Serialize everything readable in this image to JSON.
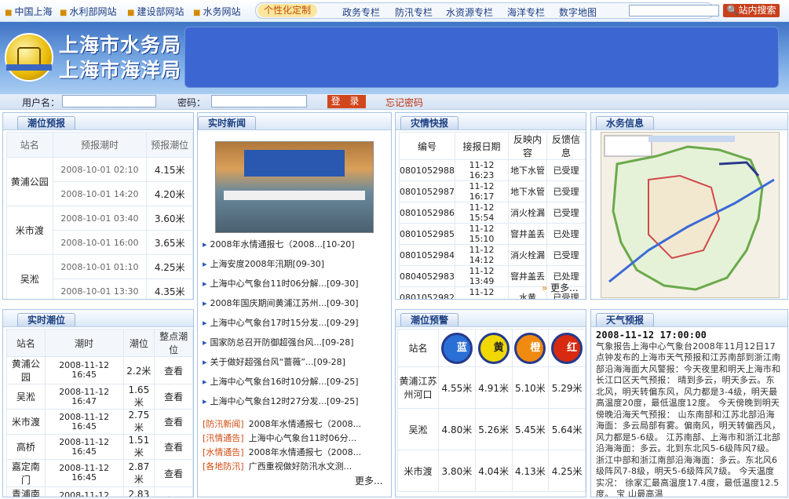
{
  "nav": {
    "links": [
      "中国上海",
      "水利部网站",
      "建设部网站",
      "水务网站"
    ],
    "tabs": [
      "个性化定制",
      "政务专栏",
      "防汛专栏",
      "水资源专栏",
      "海洋专栏",
      "数字地图"
    ],
    "search_button": "站内搜索"
  },
  "header": {
    "title1": "上海市水务局",
    "title2": "上海市海洋局"
  },
  "login": {
    "user_label": "用户名：",
    "pwd_label": "密码：",
    "login_button": "登 录",
    "forgot": "忘记密码"
  },
  "tide_forecast": {
    "title": "潮位预报",
    "headers": [
      "站名",
      "预报潮时",
      "预报潮位"
    ],
    "rows": [
      {
        "station": "黄浦公园",
        "items": [
          {
            "time": "2008-10-01 02:10",
            "level": "4.15米"
          },
          {
            "time": "2008-10-01 14:20",
            "level": "4.20米"
          }
        ]
      },
      {
        "station": "米市渡",
        "items": [
          {
            "time": "2008-10-01 03:40",
            "level": "3.60米"
          },
          {
            "time": "2008-10-01 16:00",
            "level": "3.65米"
          }
        ]
      },
      {
        "station": "吴淞",
        "items": [
          {
            "time": "2008-10-01 01:10",
            "level": "4.25米"
          },
          {
            "time": "2008-10-01 13:30",
            "level": "4.35米"
          }
        ]
      }
    ]
  },
  "realtime_tide": {
    "title": "实时潮位",
    "headers": [
      "站名",
      "潮时",
      "潮位",
      "整点潮位"
    ],
    "rows": [
      {
        "station": "黄浦公园",
        "time": "2008-11-12 16:45",
        "level": "2.2米",
        "action": "查看"
      },
      {
        "station": "吴淞",
        "time": "2008-11-12 16:47",
        "level": "1.65米",
        "action": "查看"
      },
      {
        "station": "米市渡",
        "time": "2008-11-12 16:45",
        "level": "2.75米",
        "action": "查看"
      },
      {
        "station": "高桥",
        "time": "2008-11-12 16:45",
        "level": "1.51米",
        "action": "查看"
      },
      {
        "station": "嘉定南门",
        "time": "2008-11-12 16:45",
        "level": "2.87米",
        "action": "查看"
      },
      {
        "station": "青浦南门",
        "time": "2008-11-12 16:40",
        "level": "2.83米",
        "action": "查看"
      }
    ]
  },
  "news": {
    "title": "实时新闻",
    "items": [
      "2008年水情通报七（2008...[10-20]",
      "上海安度2008年汛期[09-30]",
      "上海中心气象台11时06分解...[09-30]",
      "2008年国庆期间黄浦江苏州...[09-30]",
      "上海中心气象台17时15分发...[09-29]",
      "国家防总召开防御超强台风...[09-28]",
      "关于做好超强台风“蔷薇”...[09-28]",
      "上海中心气象台16时10分解...[09-25]",
      "上海中心气象台12时27分发...[09-25]"
    ],
    "tagged": [
      {
        "tag": "[防汛新闻]",
        "text": "2008年水情通报七（2008..."
      },
      {
        "tag": "[汛情通告]",
        "text": "上海中心气象台11时06分..."
      },
      {
        "tag": "[水情通告]",
        "text": "2008年水情通报七（2008..."
      },
      {
        "tag": "[各地防汛]",
        "text": "广西重视做好防汛水文测..."
      }
    ],
    "more": "更多..."
  },
  "disaster": {
    "title": "灾情快报",
    "headers": [
      "编号",
      "接报日期",
      "反映内容",
      "反馈信息"
    ],
    "rows": [
      [
        "0801052988",
        "11-12 16:23",
        "地下水管",
        "已受理"
      ],
      [
        "0801052987",
        "11-12 16:17",
        "地下水管",
        "已受理"
      ],
      [
        "0801052986",
        "11-12 15:54",
        "消火栓漏",
        "已受理"
      ],
      [
        "0801052985",
        "11-12 15:10",
        "窨井盖丢",
        "已处理"
      ],
      [
        "0801052984",
        "11-12 14:12",
        "消火栓漏",
        "已受理"
      ],
      [
        "0804052983",
        "11-12 13:49",
        "窨井盖丢",
        "已处理"
      ],
      [
        "0801052982",
        "11-12 12:58",
        "水黄",
        "已受理"
      ]
    ],
    "more": "更多..."
  },
  "water_info": {
    "title": "水务信息"
  },
  "warning": {
    "title": "潮位预警",
    "col_station": "站名",
    "levels": [
      {
        "label": "蓝",
        "color": "#2a6fd6"
      },
      {
        "label": "黄",
        "color": "#f0d800"
      },
      {
        "label": "橙",
        "color": "#f08a10"
      },
      {
        "label": "红",
        "color": "#d82a10"
      }
    ],
    "rows": [
      {
        "station": "黄浦江苏州河口",
        "values": [
          "4.55米",
          "4.91米",
          "5.10米",
          "5.29米"
        ]
      },
      {
        "station": "吴淞",
        "values": [
          "4.80米",
          "5.26米",
          "5.45米",
          "5.64米"
        ]
      },
      {
        "station": "米市渡",
        "values": [
          "3.80米",
          "4.04米",
          "4.13米",
          "4.25米"
        ]
      }
    ]
  },
  "weather": {
    "title": "天气预报",
    "date": "2008-11-12 17:00:00",
    "text": "气象报告上海中心气象台2008年11月12日17点钟发布的上海市天气预报和江苏南部到浙江南部沿海海面大风警报：今天夜里和明天上海市和长江口区天气预报： 晴到多云，明天多云。东北风，明天转偏东风，风力都是3-4级，明天最高温度20度，最低温度12度。 今天傍晚到明天傍晚沿海天气预报： 山东南部和江苏北部沿海海面：多云局部有雾。偏南风，明天转偏西风，风力都是5-6级。 江苏南部、上海市和浙江北部沿海海面：多云。北到东北风5-6级阵风7级。 浙江中部和浙江南部沿海海面：多云。东北风6级阵风7-8级，明天5-6级阵风7级。 今天温度实况： 徐家汇最高温度17.4度，最低温度12.5度。 宝 山最高温"
  }
}
